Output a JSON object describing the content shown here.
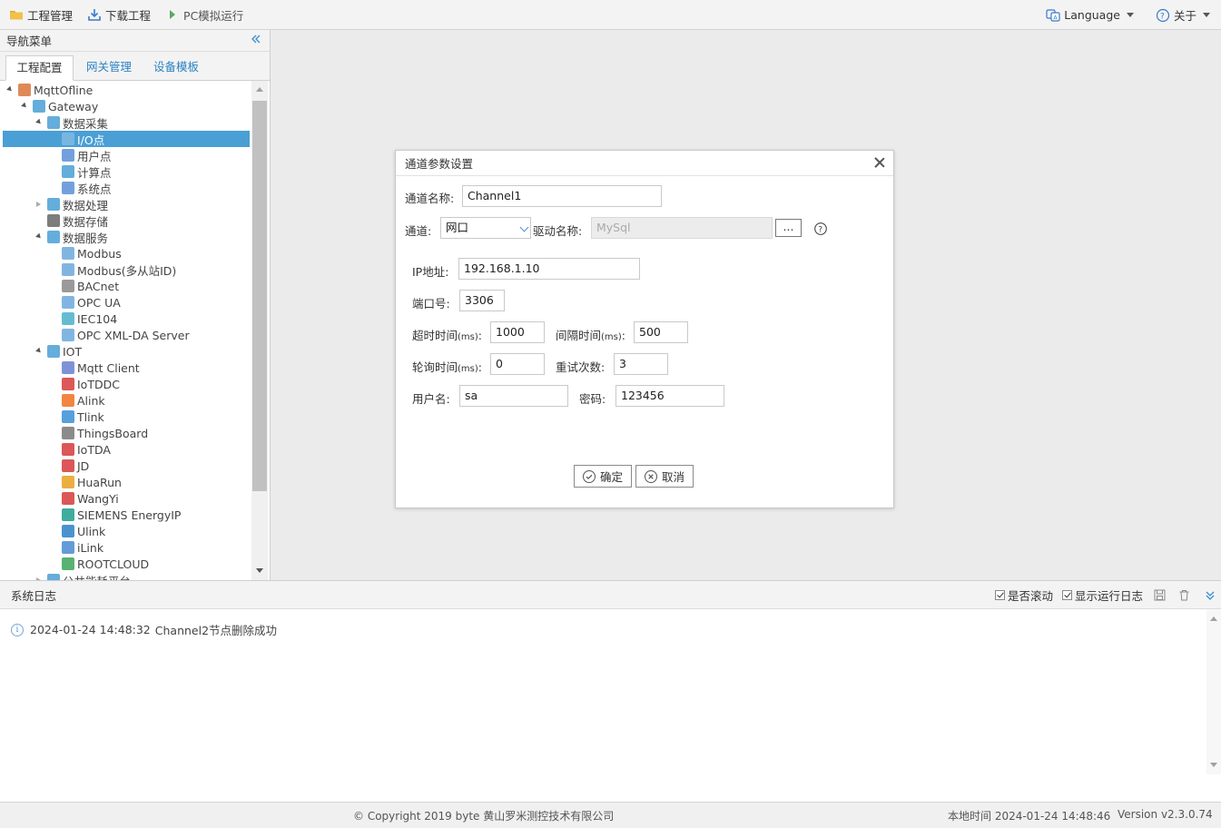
{
  "toolbar": {
    "project_mgmt": "工程管理",
    "download_project": "下载工程",
    "pc_simulate": "PC模拟运行",
    "language": "Language",
    "about": "关于"
  },
  "nav": {
    "title": "导航菜单",
    "collapse_icon": "double-chevron-left-icon",
    "tabs": [
      "工程配置",
      "网关管理",
      "设备模板"
    ],
    "active_tab": 0
  },
  "tree": [
    {
      "label": "MqttOfline",
      "depth": 0,
      "state": "open",
      "icon": "project-icon",
      "color": "#d9743a"
    },
    {
      "label": "Gateway",
      "depth": 1,
      "state": "open",
      "icon": "gateway-icon",
      "color": "#4a9fd5"
    },
    {
      "label": "数据采集",
      "depth": 2,
      "state": "open",
      "icon": "chart-icon",
      "color": "#4a9fd5"
    },
    {
      "label": "I/O点",
      "depth": 3,
      "state": "none",
      "icon": "io-icon",
      "color": "#9ec9ea",
      "selected": true
    },
    {
      "label": "用户点",
      "depth": 3,
      "state": "none",
      "icon": "user-point-icon",
      "color": "#5b8fd6"
    },
    {
      "label": "计算点",
      "depth": 3,
      "state": "none",
      "icon": "calc-icon",
      "color": "#4a9fd5"
    },
    {
      "label": "系统点",
      "depth": 3,
      "state": "none",
      "icon": "system-point-icon",
      "color": "#5b8fd6"
    },
    {
      "label": "数据处理",
      "depth": 2,
      "state": "closed",
      "icon": "process-icon",
      "color": "#4a9fd5"
    },
    {
      "label": "数据存储",
      "depth": 2,
      "state": "none",
      "icon": "database-icon",
      "color": "#666"
    },
    {
      "label": "数据服务",
      "depth": 2,
      "state": "open",
      "icon": "service-icon",
      "color": "#4a9fd5"
    },
    {
      "label": "Modbus",
      "depth": 3,
      "state": "none",
      "icon": "modbus-icon",
      "color": "#6ba8dc"
    },
    {
      "label": "Modbus(多从站ID)",
      "depth": 3,
      "state": "none",
      "icon": "modbus-icon",
      "color": "#6ba8dc"
    },
    {
      "label": "BACnet",
      "depth": 3,
      "state": "none",
      "icon": "bacnet-icon",
      "color": "#888"
    },
    {
      "label": "OPC UA",
      "depth": 3,
      "state": "none",
      "icon": "opcua-icon",
      "color": "#6ba8dc"
    },
    {
      "label": "IEC104",
      "depth": 3,
      "state": "none",
      "icon": "iec104-icon",
      "color": "#4ab0c9"
    },
    {
      "label": "OPC XML-DA Server",
      "depth": 3,
      "state": "none",
      "icon": "opcxml-icon",
      "color": "#6ba8dc"
    },
    {
      "label": "IOT",
      "depth": 2,
      "state": "open",
      "icon": "iot-icon",
      "color": "#4a9fd5"
    },
    {
      "label": "Mqtt Client",
      "depth": 3,
      "state": "none",
      "icon": "mqtt-icon",
      "color": "#6a7fd0"
    },
    {
      "label": "IoTDDC",
      "depth": 3,
      "state": "none",
      "icon": "iotddc-icon",
      "color": "#d63a3a"
    },
    {
      "label": "Alink",
      "depth": 3,
      "state": "none",
      "icon": "alink-icon",
      "color": "#f07020"
    },
    {
      "label": "Tlink",
      "depth": 3,
      "state": "none",
      "icon": "tlink-icon",
      "color": "#3a8fd6"
    },
    {
      "label": "ThingsBoard",
      "depth": 3,
      "state": "none",
      "icon": "thingsboard-icon",
      "color": "#777"
    },
    {
      "label": "IoTDA",
      "depth": 3,
      "state": "none",
      "icon": "huawei-icon",
      "color": "#d63a3a"
    },
    {
      "label": "JD",
      "depth": 3,
      "state": "none",
      "icon": "jd-icon",
      "color": "#d63a3a"
    },
    {
      "label": "HuaRun",
      "depth": 3,
      "state": "none",
      "icon": "huarun-icon",
      "color": "#e8a020"
    },
    {
      "label": "WangYi",
      "depth": 3,
      "state": "none",
      "icon": "wangyi-icon",
      "color": "#d63a3a"
    },
    {
      "label": "SIEMENS EnergyIP",
      "depth": 3,
      "state": "none",
      "icon": "siemens-icon",
      "color": "#1e9e8c"
    },
    {
      "label": "Ulink",
      "depth": 3,
      "state": "none",
      "icon": "ulink-icon",
      "color": "#2a7fc6"
    },
    {
      "label": "iLink",
      "depth": 3,
      "state": "none",
      "icon": "ilink-icon",
      "color": "#4a8ad0"
    },
    {
      "label": "ROOTCLOUD",
      "depth": 3,
      "state": "none",
      "icon": "rootcloud-icon",
      "color": "#3aa55a"
    },
    {
      "label": "公共能耗平台",
      "depth": 2,
      "state": "closed",
      "icon": "energy-icon",
      "color": "#4a9fd5"
    }
  ],
  "dialog": {
    "title": "通道参数设置",
    "channel_name_label": "通道名称:",
    "channel_name_value": "Channel1",
    "channel_label": "通道:",
    "channel_value": "网口",
    "driver_label": "驱动名称:",
    "driver_value": "MySql",
    "browse_label": "...",
    "ip_label": "IP地址:",
    "ip_value": "192.168.1.10",
    "port_label": "端口号:",
    "port_value": "3306",
    "timeout_label": "超时时间",
    "timeout_unit": "(ms)",
    "timeout_value": "1000",
    "interval_label": "间隔时间",
    "interval_unit": "(ms)",
    "interval_value": "500",
    "poll_label": "轮询时间",
    "poll_unit": "(ms)",
    "poll_value": "0",
    "retry_label": "重试次数:",
    "retry_value": "3",
    "user_label": "用户名:",
    "user_value": "sa",
    "password_label": "密码:",
    "password_value": "123456",
    "ok_label": "确定",
    "cancel_label": "取消",
    "colon": ":"
  },
  "log": {
    "title": "系统日志",
    "auto_scroll": "是否滚动",
    "show_runtime": "显示运行日志",
    "entries": [
      {
        "time": "2024-01-24 14:48:32",
        "message": "Channel2节点删除成功"
      }
    ]
  },
  "footer": {
    "copyright": "© Copyright 2019 byte 黄山罗米测控技术有限公司",
    "local_time": "本地时间 2024-01-24 14:48:46",
    "version": "Version v2.3.0.74"
  },
  "colors": {
    "accent": "#4a9fd5",
    "link": "#2e84c6"
  }
}
